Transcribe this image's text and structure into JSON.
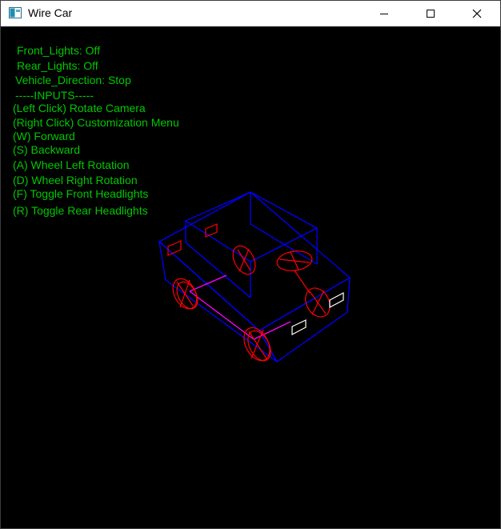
{
  "window": {
    "title": "Wire Car",
    "controls": [
      "minimize",
      "maximize",
      "close"
    ]
  },
  "status": {
    "front_lights": "Front_Lights: Off",
    "rear_lights": "Rear_Lights: Off",
    "vehicle_direction": "Vehicle_Direction: Stop"
  },
  "inputs": {
    "header": "-----INPUTS-----",
    "left_click": "(Left Click) Rotate Camera",
    "right_click": "(Right Click) Customization Menu",
    "w": "(W) Forward",
    "s": "(S) Backward",
    "a": "(A) Wheel Left Rotation",
    "d": "(D) Wheel Right Rotation",
    "f": "(F) Toggle Front Headlights",
    "r": "(R) Toggle Rear Headlights"
  },
  "colors": {
    "hud_text": "#00c800",
    "body_wire": "#0000ff",
    "wheel_wire": "#ff0000",
    "axle": "#ff00ff",
    "headlight": "#ffffff",
    "background": "#000000"
  },
  "icons": {
    "app": "app-window-icon",
    "minimize": "minimize-icon",
    "maximize": "maximize-icon",
    "close": "close-icon"
  }
}
